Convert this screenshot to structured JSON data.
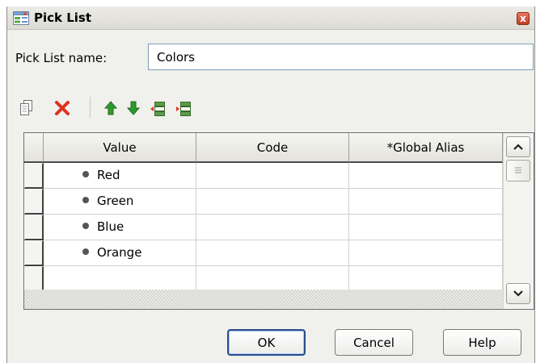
{
  "window": {
    "title": "Pick List",
    "close_glyph": "x",
    "icons": {
      "title": "pick-list-icon",
      "close": "close-icon"
    }
  },
  "form": {
    "name_label": "Pick List name:",
    "name_value": "Colors"
  },
  "toolbar": {
    "icons": [
      "copy-icon",
      "delete-icon",
      "move-up-icon",
      "move-down-icon",
      "remove-row-icon",
      "insert-row-icon"
    ]
  },
  "grid": {
    "columns": [
      "Value",
      "Code",
      "*Global Alias"
    ],
    "rows": [
      {
        "value": "Red",
        "code": "",
        "alias": ""
      },
      {
        "value": "Green",
        "code": "",
        "alias": ""
      },
      {
        "value": "Blue",
        "code": "",
        "alias": ""
      },
      {
        "value": "Orange",
        "code": "",
        "alias": ""
      },
      {
        "value": "",
        "code": "",
        "alias": ""
      }
    ]
  },
  "buttons": {
    "ok": "OK",
    "cancel": "Cancel",
    "help": "Help"
  },
  "colors": {
    "delete_red": "#e0301e",
    "arrow_green": "#2e9a2e",
    "close_red": "#c33b23",
    "default_button_border": "#2a4d8f"
  }
}
